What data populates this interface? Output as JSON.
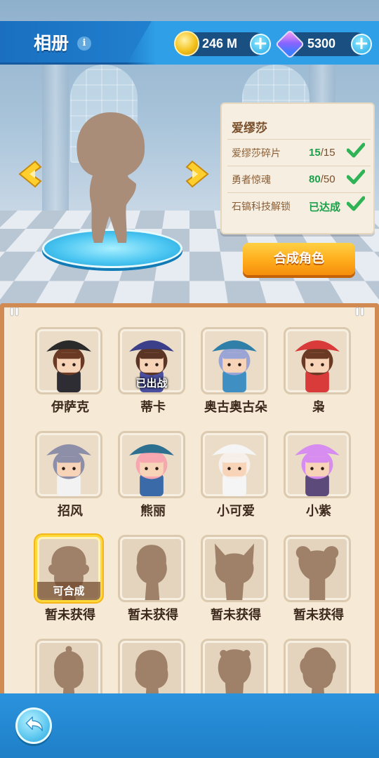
{
  "header": {
    "title": "相册",
    "info_icon": "info-icon",
    "coins": {
      "icon": "coin-icon",
      "value": "246 M",
      "add_icon": "plus-icon"
    },
    "gems": {
      "icon": "gem-icon",
      "value": "5300",
      "add_icon": "plus-icon"
    }
  },
  "preview": {
    "character_name": "爱缪莎",
    "prev_arrow_icon": "chevron-left-icon",
    "next_arrow_icon": "chevron-right-icon",
    "requirements": [
      {
        "label": "爱缪莎碎片",
        "current": "15",
        "separator": "/",
        "total": "15",
        "check_icon": "check-icon"
      },
      {
        "label": "勇者惊魂",
        "current": "80",
        "separator": "/",
        "total": "50",
        "check_icon": "check-icon"
      },
      {
        "label": "石镐科技解锁",
        "current": "已达成",
        "separator": "",
        "total": "",
        "check_icon": "check-icon"
      }
    ],
    "synthesize_button": "合成角色"
  },
  "roster": [
    {
      "name": "伊萨克",
      "badge": "",
      "locked": false,
      "hat": "#2a2a2a",
      "hair": "#6b3a24",
      "outfit": "#2d2d33"
    },
    {
      "name": "蒂卡",
      "badge": "已出战",
      "locked": false,
      "hat": "#3b3f8a",
      "hair": "#5a3424",
      "outfit": "#4a4fa0"
    },
    {
      "name": "奥古奥古朵",
      "badge": "",
      "locked": false,
      "hat": "#2f7fa8",
      "hair": "#9aa5d6",
      "outfit": "#3f8fc2"
    },
    {
      "name": "枭",
      "badge": "",
      "locked": false,
      "hat": "#d93a3a",
      "hair": "#6b3a24",
      "outfit": "#d93a3a"
    },
    {
      "name": "招风",
      "badge": "",
      "locked": false,
      "hat": "#8d8fa8",
      "hair": "#8d8fa8",
      "outfit": "#f2f2f2"
    },
    {
      "name": "熊丽",
      "badge": "",
      "locked": false,
      "hat": "#2d6f8f",
      "hair": "#f6a7b0",
      "outfit": "#3a6aa8"
    },
    {
      "name": "小可爱",
      "badge": "",
      "locked": false,
      "hat": "#f5f5f5",
      "hair": "#f7f0ea",
      "outfit": "#f5f5f5"
    },
    {
      "name": "小紫",
      "badge": "",
      "locked": false,
      "hat": "#d78cf0",
      "hair": "#d78cf0",
      "outfit": "#5b4a7a"
    },
    {
      "name": "暂未获得",
      "badge": "可合成",
      "locked": true,
      "glow": true
    },
    {
      "name": "暂未获得",
      "badge": "",
      "locked": true
    },
    {
      "name": "暂未获得",
      "badge": "",
      "locked": true
    },
    {
      "name": "暂未获得",
      "badge": "",
      "locked": true
    },
    {
      "name": "",
      "badge": "",
      "locked": true
    },
    {
      "name": "",
      "badge": "",
      "locked": true
    },
    {
      "name": "",
      "badge": "",
      "locked": true
    },
    {
      "name": "",
      "badge": "",
      "locked": true
    }
  ],
  "footer": {
    "back_icon": "back-arrow-icon"
  },
  "colors": {
    "accent": "#2a8fdc",
    "panel_border": "#d08a52",
    "check_green": "#1aa04a",
    "button_orange": "#ffac1c"
  }
}
